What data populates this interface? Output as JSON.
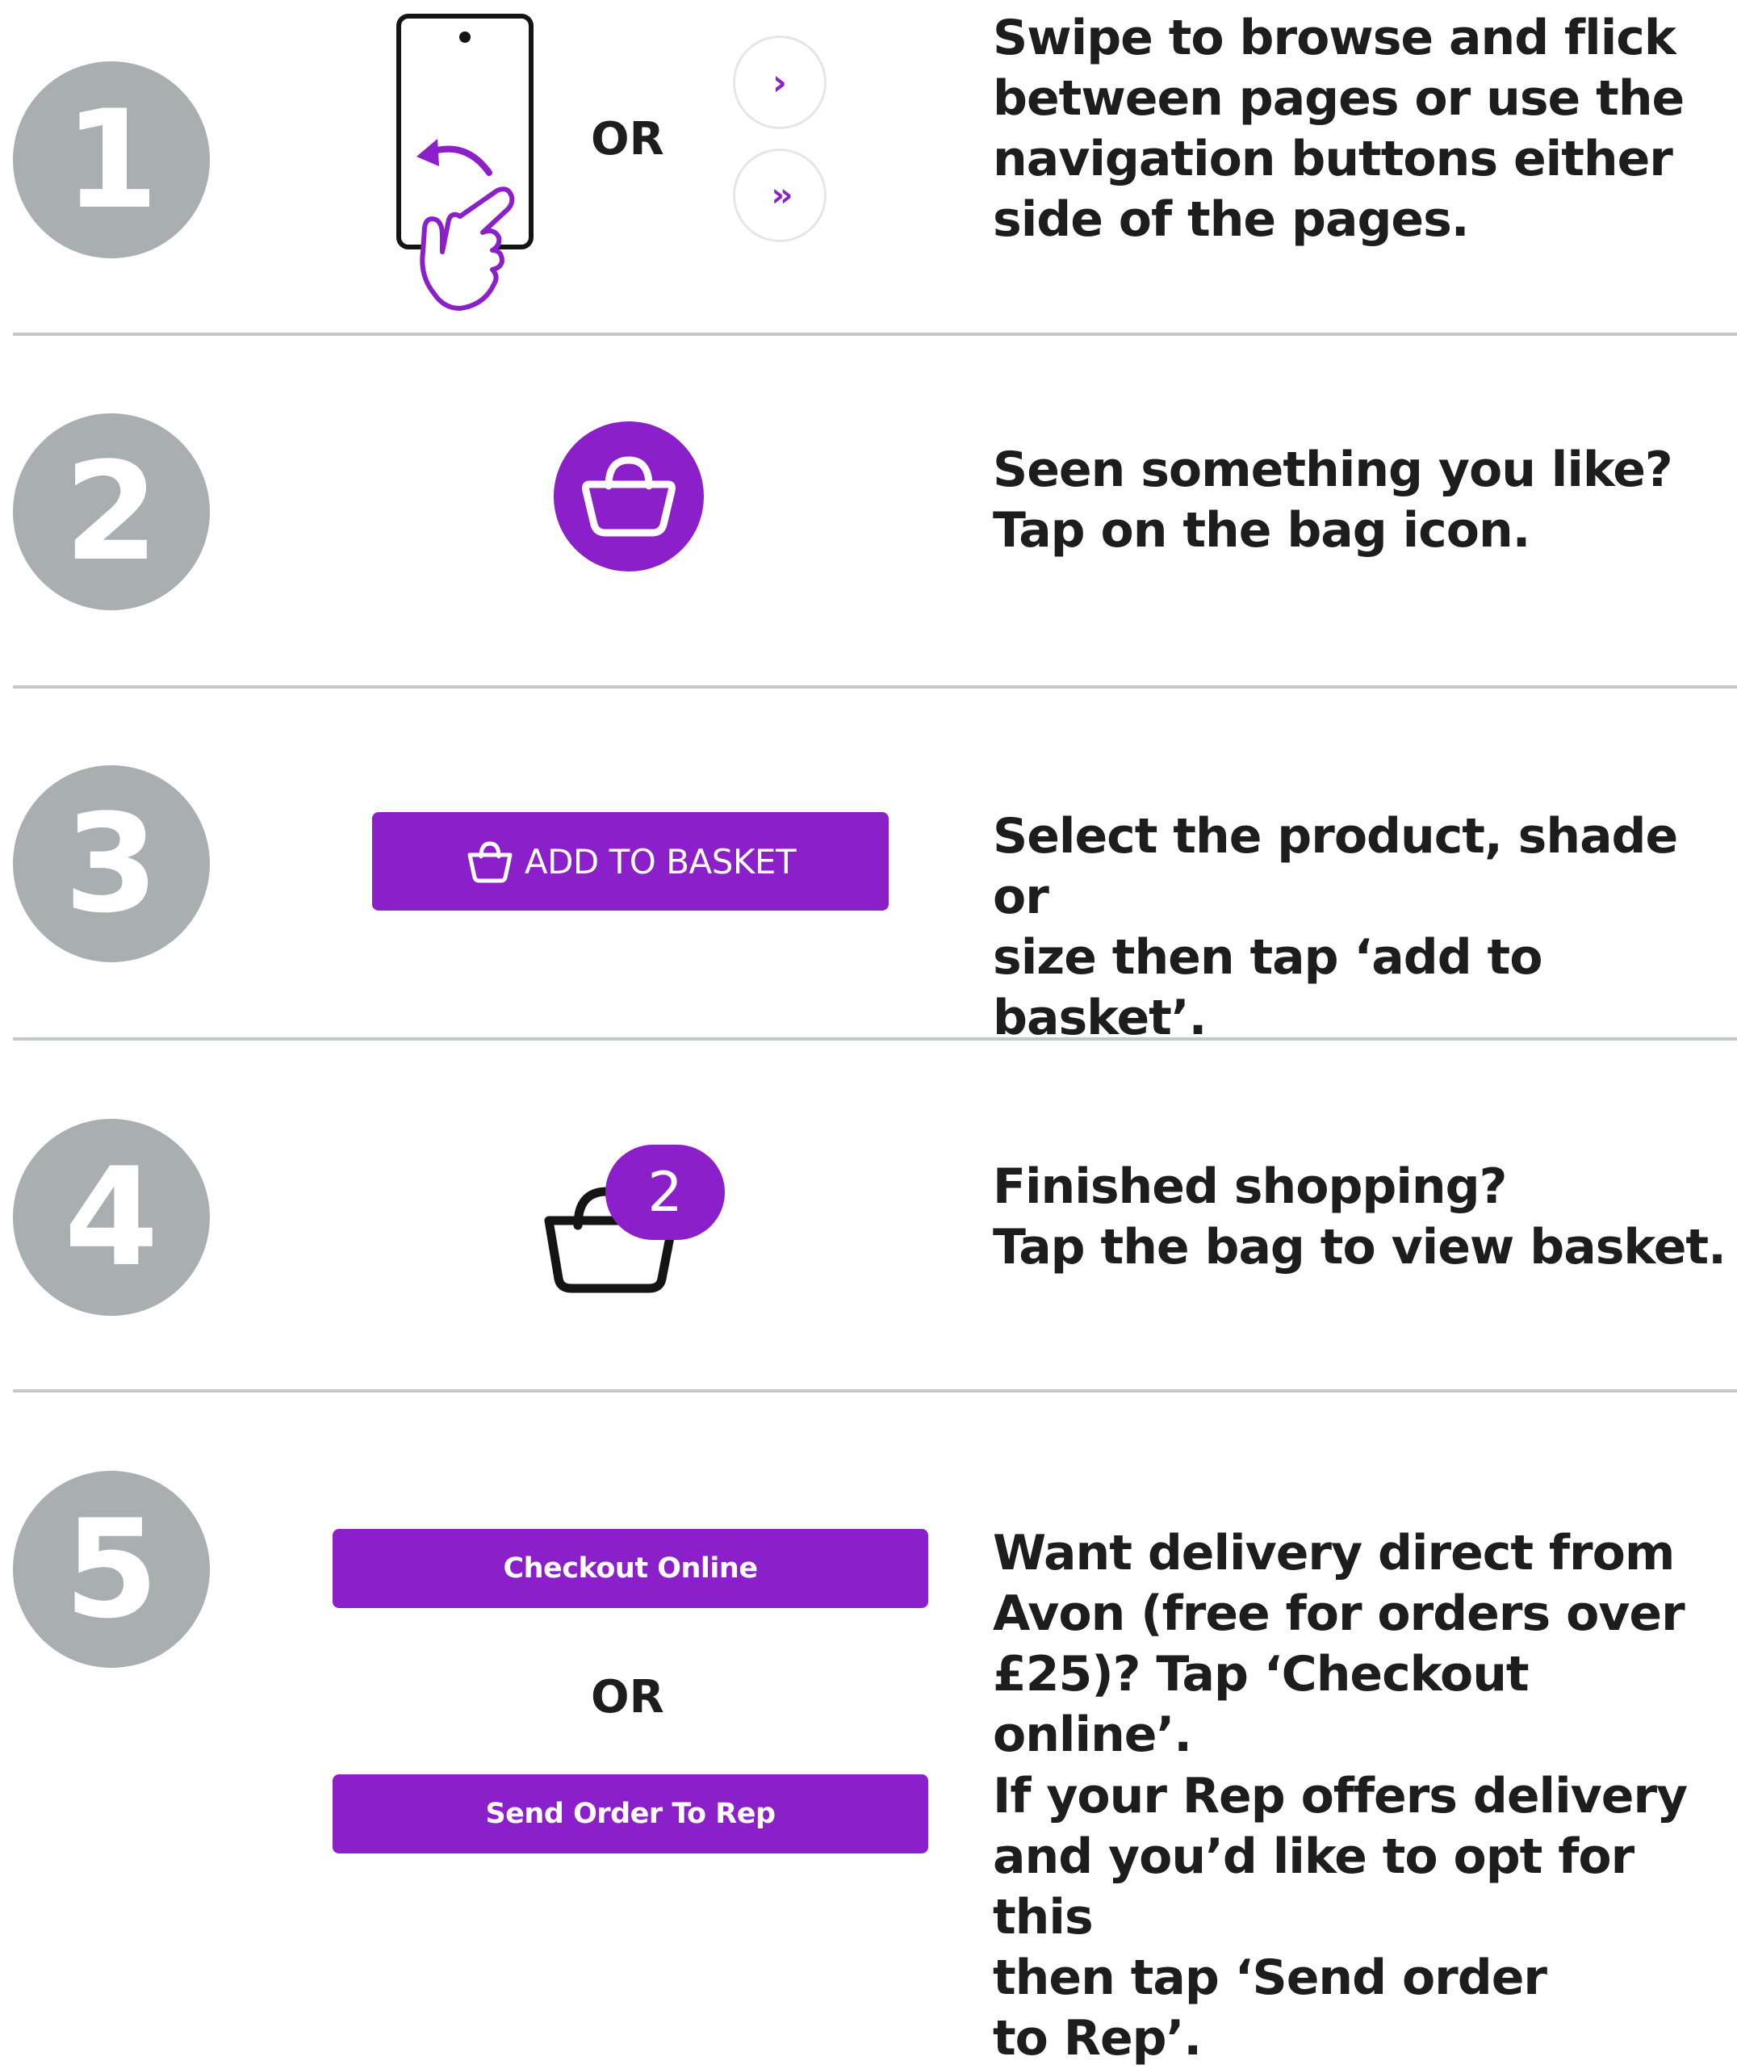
{
  "colors": {
    "accent": "#8b1fc9",
    "step_circle": "#a9afb1",
    "divider": "#c3c8ca",
    "text": "#1d1d1d"
  },
  "steps": [
    {
      "number": "1",
      "or": "OR",
      "icons": [
        "phone-swipe-icon",
        "next-page-icon",
        "skip-pages-icon"
      ],
      "next_glyph": "›",
      "skip_glyph": "››",
      "description": [
        "Swipe to browse and flick",
        "between pages or use the",
        "navigation buttons either",
        "side of the pages."
      ]
    },
    {
      "number": "2",
      "icons": [
        "bag-icon"
      ],
      "description": [
        "Seen something you like?",
        "Tap on the bag icon."
      ]
    },
    {
      "number": "3",
      "button_label": "ADD TO BASKET",
      "icons": [
        "basket-outline-icon"
      ],
      "description": [
        "Select the product, shade or",
        "size then tap ‘add to basket’."
      ]
    },
    {
      "number": "4",
      "badge_count": "2",
      "icons": [
        "basket-icon"
      ],
      "description": [
        "Finished shopping?",
        "Tap the bag to view basket."
      ]
    },
    {
      "number": "5",
      "checkout_label": "Checkout Online",
      "or": "OR",
      "send_label": "Send Order To Rep",
      "description": [
        "Want delivery direct from",
        "Avon (free for orders over",
        "£25)? Tap ‘Checkout online’."
      ],
      "description_2": [
        "If your Rep offers delivery",
        "and you’d like to opt for this",
        "then tap ‘Send order",
        "to Rep’."
      ]
    }
  ]
}
